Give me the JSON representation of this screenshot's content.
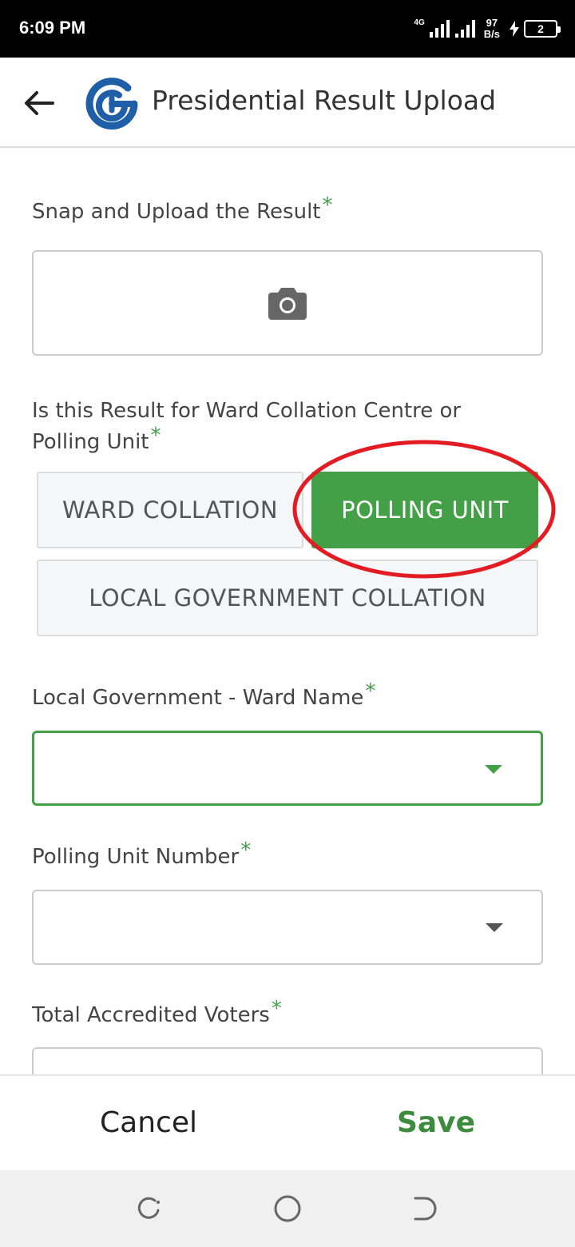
{
  "status_bar": {
    "time": "6:09 PM",
    "network_type": "4G",
    "speed_value": "97",
    "speed_unit": "B/s",
    "battery_level": "2"
  },
  "app_bar": {
    "title": "Presidential Result Upload",
    "back_icon": "arrow-left-icon",
    "logo": "app-logo"
  },
  "form": {
    "upload": {
      "label": "Snap and Upload the Result",
      "required_mark": "*",
      "icon": "camera-icon"
    },
    "result_type": {
      "label": "Is this Result for Ward Collation Centre or Polling Unit",
      "required_mark": "*",
      "options": [
        {
          "label": "WARD COLLATION",
          "selected": false
        },
        {
          "label": "POLLING UNIT",
          "selected": true
        },
        {
          "label": "LOCAL GOVERNMENT COLLATION",
          "selected": false
        }
      ]
    },
    "ward_name": {
      "label": "Local Government - Ward Name",
      "required_mark": "*",
      "value": ""
    },
    "polling_unit_number": {
      "label": "Polling Unit Number",
      "required_mark": "*",
      "value": ""
    },
    "total_accredited_voters": {
      "label": "Total Accredited Voters",
      "required_mark": "*",
      "value": ""
    }
  },
  "actions": {
    "cancel": "Cancel",
    "save": "Save"
  },
  "colors": {
    "accent_green": "#43a047",
    "highlight_red": "#e31b23",
    "logo_blue": "#1f5fa8"
  }
}
